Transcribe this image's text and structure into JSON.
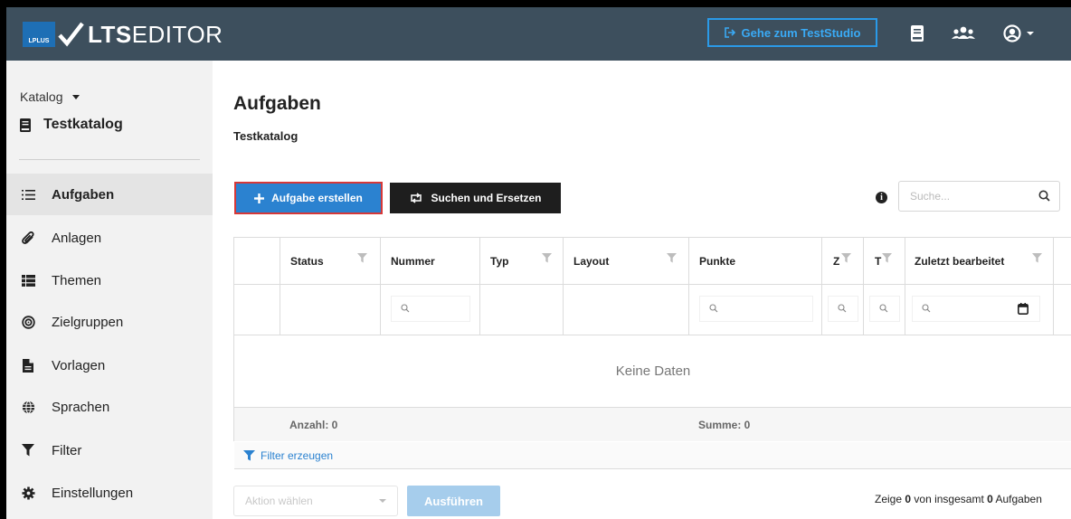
{
  "app": {
    "logo_badge": "LPLUS",
    "logo_bold": "LTS",
    "logo_light": "EDITOR",
    "teststudio_button": "Gehe zum TestStudio"
  },
  "sidebar": {
    "catalog_dropdown": "Katalog",
    "catalog_title": "Testkatalog",
    "items": [
      {
        "label": "Aufgaben",
        "icon": "list-icon",
        "active": true
      },
      {
        "label": "Anlagen",
        "icon": "paperclip-icon",
        "active": false
      },
      {
        "label": "Themen",
        "icon": "grid-list-icon",
        "active": false
      },
      {
        "label": "Zielgruppen",
        "icon": "target-icon",
        "active": false
      },
      {
        "label": "Vorlagen",
        "icon": "file-icon",
        "active": false
      },
      {
        "label": "Sprachen",
        "icon": "globe-icon",
        "active": false
      },
      {
        "label": "Filter",
        "icon": "filter-icon",
        "active": false
      },
      {
        "label": "Einstellungen",
        "icon": "gear-icon",
        "active": false
      }
    ]
  },
  "main": {
    "title": "Aufgaben",
    "subtitle": "Testkatalog",
    "create_button": "Aufgabe erstellen",
    "replace_button": "Suchen und Ersetzen",
    "search_placeholder": "Suche..."
  },
  "table": {
    "columns": [
      "Status",
      "Nummer",
      "Typ",
      "Layout",
      "Punkte",
      "Z",
      "T",
      "Zuletzt bearbeitet"
    ],
    "empty_text": "Keine Daten",
    "count_label": "Anzahl: 0",
    "sum_label": "Summe: 0",
    "filter_link": "Filter erzeugen"
  },
  "footer": {
    "action_placeholder": "Aktion wählen",
    "run_button": "Ausführen",
    "summary_prefix": "Zeige",
    "summary_shown": "0",
    "summary_middle": "von insgesamt",
    "summary_total": "0",
    "summary_suffix": "Aufgaben"
  },
  "colors": {
    "topbar": "#3d4f5d",
    "accent": "#2b82d0",
    "teststudio": "#2a9ae8",
    "highlight": "#d63838"
  }
}
